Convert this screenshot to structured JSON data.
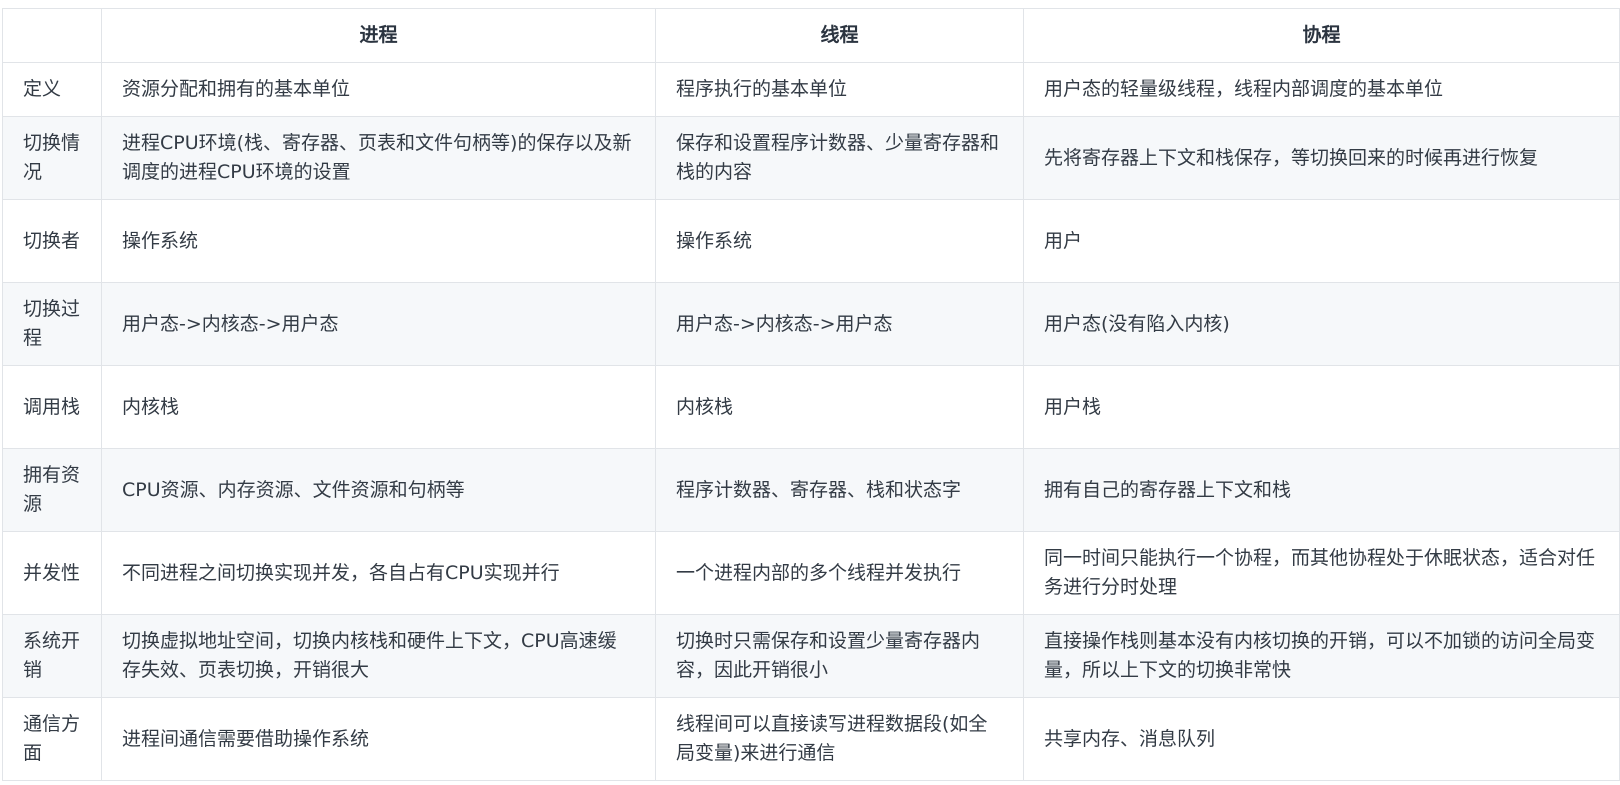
{
  "headers": [
    "",
    "进程",
    "线程",
    "协程"
  ],
  "rows": [
    {
      "label": "定义",
      "process": "资源分配和拥有的基本单位",
      "thread": "程序执行的基本单位",
      "coroutine": "用户态的轻量级线程，线程内部调度的基本单位"
    },
    {
      "label": "切换情况",
      "process": "进程CPU环境(栈、寄存器、页表和文件句柄等)的保存以及新调度的进程CPU环境的设置",
      "thread": "保存和设置程序计数器、少量寄存器和栈的内容",
      "coroutine": "先将寄存器上下文和栈保存，等切换回来的时候再进行恢复"
    },
    {
      "label": "切换者",
      "process": "操作系统",
      "thread": "操作系统",
      "coroutine": "用户"
    },
    {
      "label": "切换过程",
      "process": "用户态->内核态->用户态",
      "thread": "用户态->内核态->用户态",
      "coroutine": "用户态(没有陷入内核)"
    },
    {
      "label": "调用栈",
      "process": "内核栈",
      "thread": "内核栈",
      "coroutine": "用户栈"
    },
    {
      "label": "拥有资源",
      "process": "CPU资源、内存资源、文件资源和句柄等",
      "thread": "程序计数器、寄存器、栈和状态字",
      "coroutine": "拥有自己的寄存器上下文和栈"
    },
    {
      "label": "并发性",
      "process": "不同进程之间切换实现并发，各自占有CPU实现并行",
      "thread": "一个进程内部的多个线程并发执行",
      "coroutine": "同一时间只能执行一个协程，而其他协程处于休眠状态，适合对任务进行分时处理"
    },
    {
      "label": "系统开销",
      "process": "切换虚拟地址空间，切换内核栈和硬件上下文，CPU高速缓存失效、页表切换，开销很大",
      "thread": "切换时只需保存和设置少量寄存器内容，因此开销很小",
      "coroutine": "直接操作栈则基本没有内核切换的开销，可以不加锁的访问全局变量，所以上下文的切换非常快"
    },
    {
      "label": "通信方面",
      "process": "进程间通信需要借助操作系统",
      "thread": "线程间可以直接读写进程数据段(如全局变量)来进行通信",
      "coroutine": "共享内存、消息队列"
    }
  ]
}
